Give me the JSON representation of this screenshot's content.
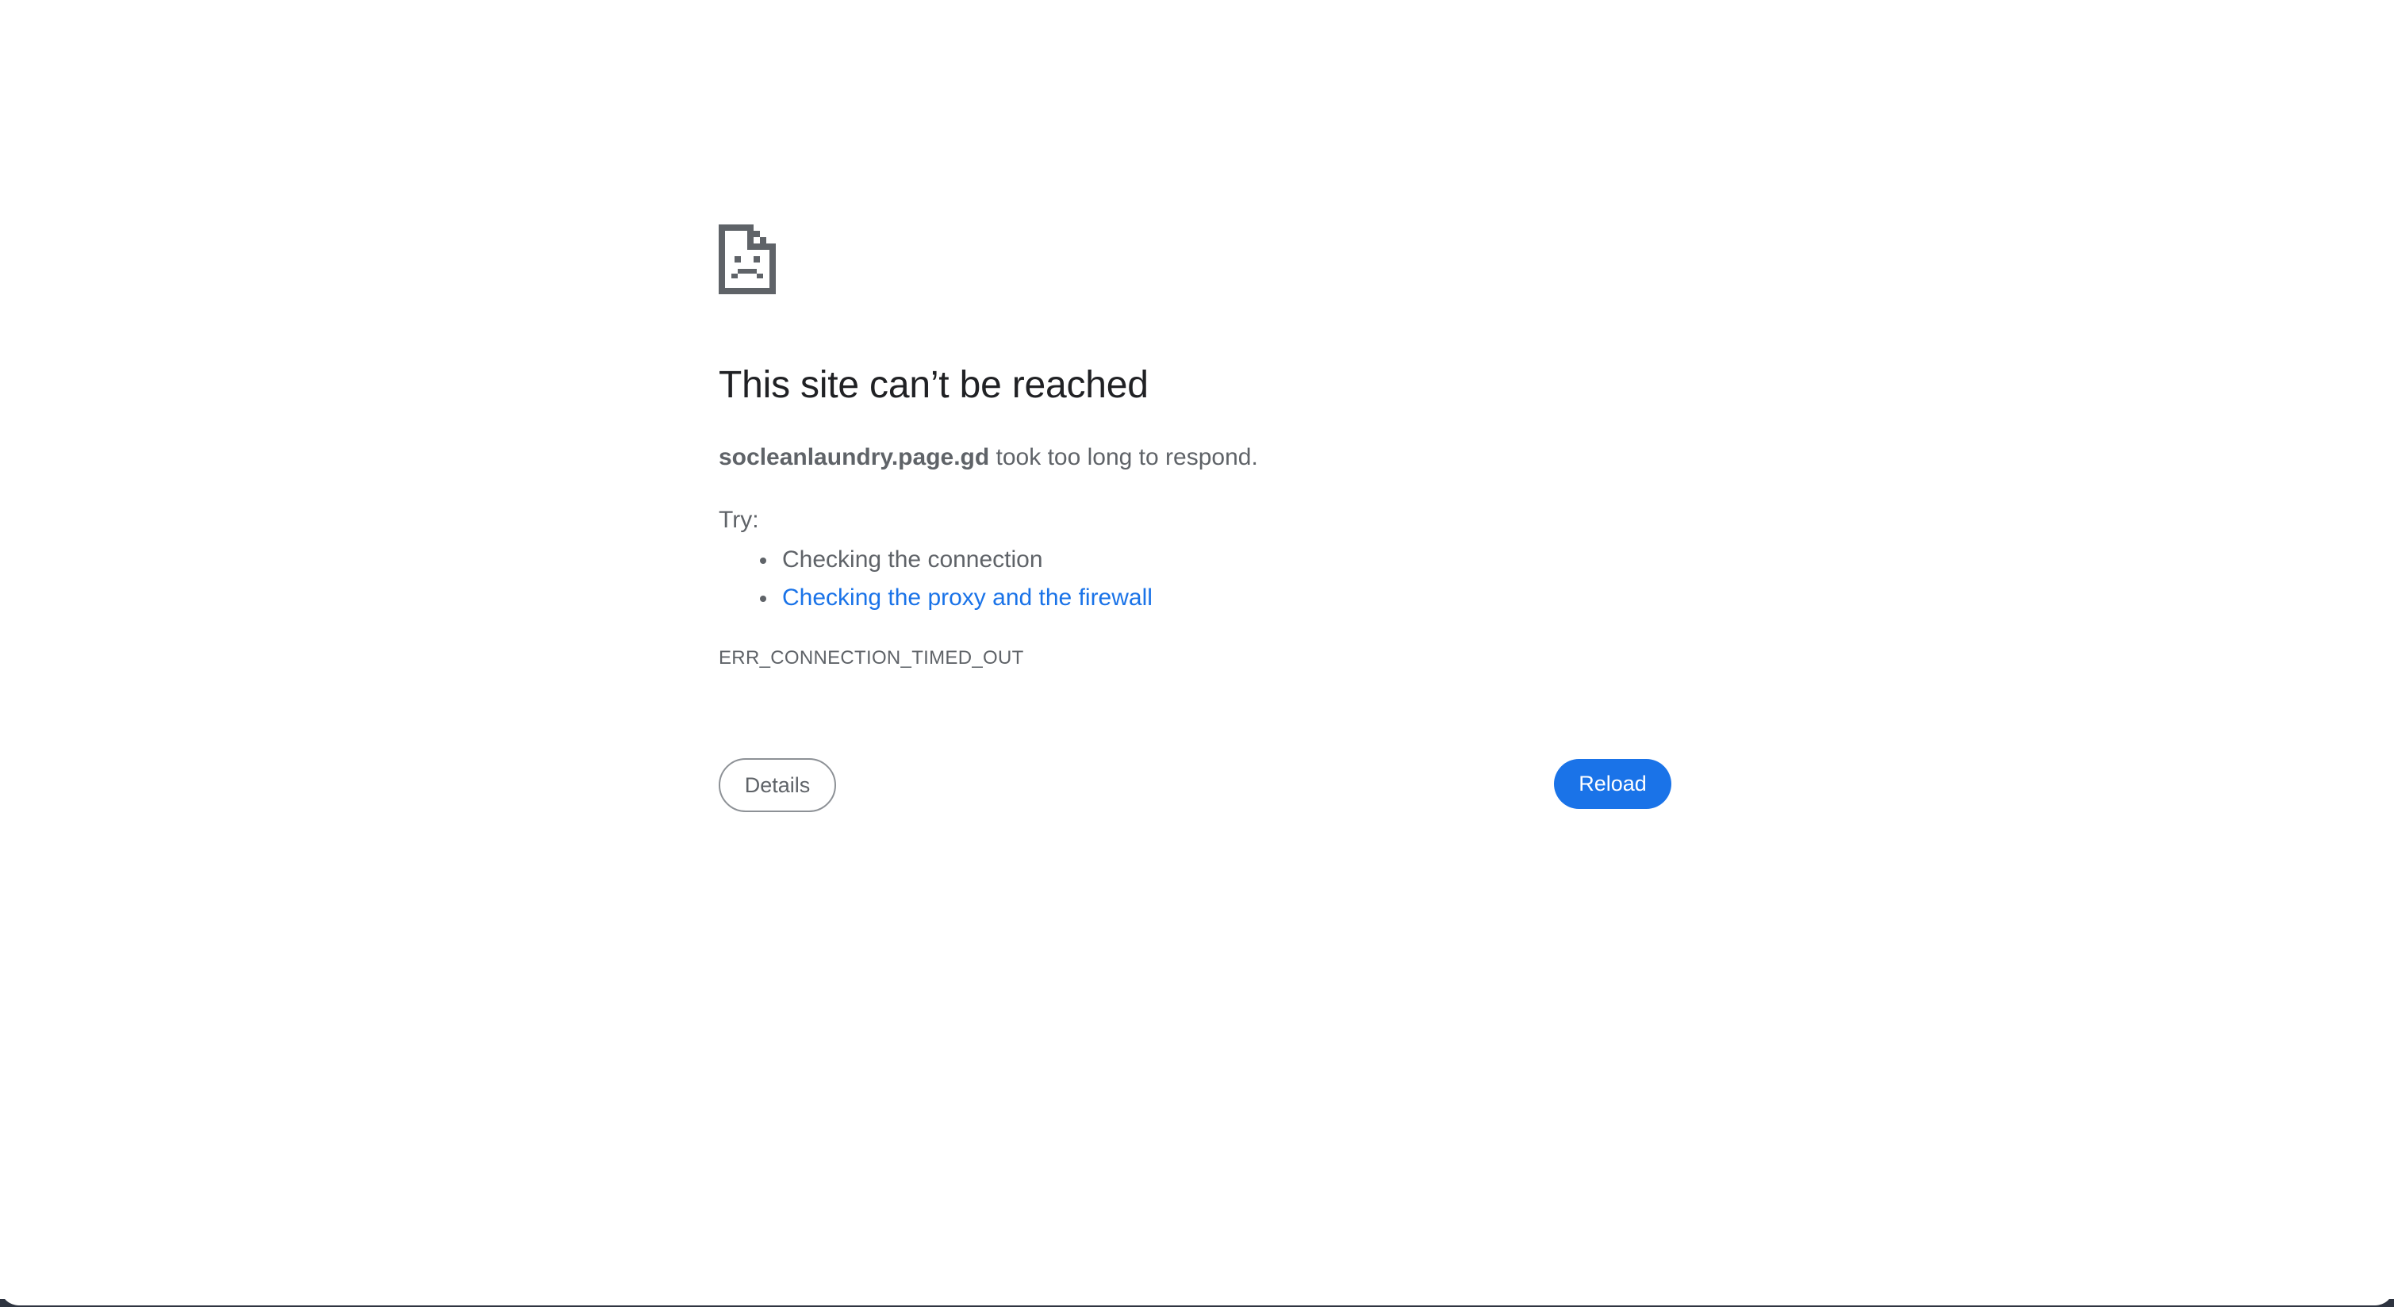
{
  "error": {
    "icon": "sad-document-icon",
    "title": "This site can’t be reached",
    "host": "socleanlaundry.page.gd",
    "summary_suffix": " took too long to respond.",
    "try_label": "Try:",
    "suggestions": [
      {
        "label": "Checking the connection",
        "is_link": false
      },
      {
        "label": "Checking the proxy and the firewall",
        "is_link": true
      }
    ],
    "code": "ERR_CONNECTION_TIMED_OUT"
  },
  "buttons": {
    "details_label": "Details",
    "reload_label": "Reload"
  },
  "colors": {
    "title": "#202124",
    "body_text": "#5f6368",
    "link": "#1a73e8",
    "reload_bg": "#1a73e8",
    "icon": "#5f6368"
  }
}
